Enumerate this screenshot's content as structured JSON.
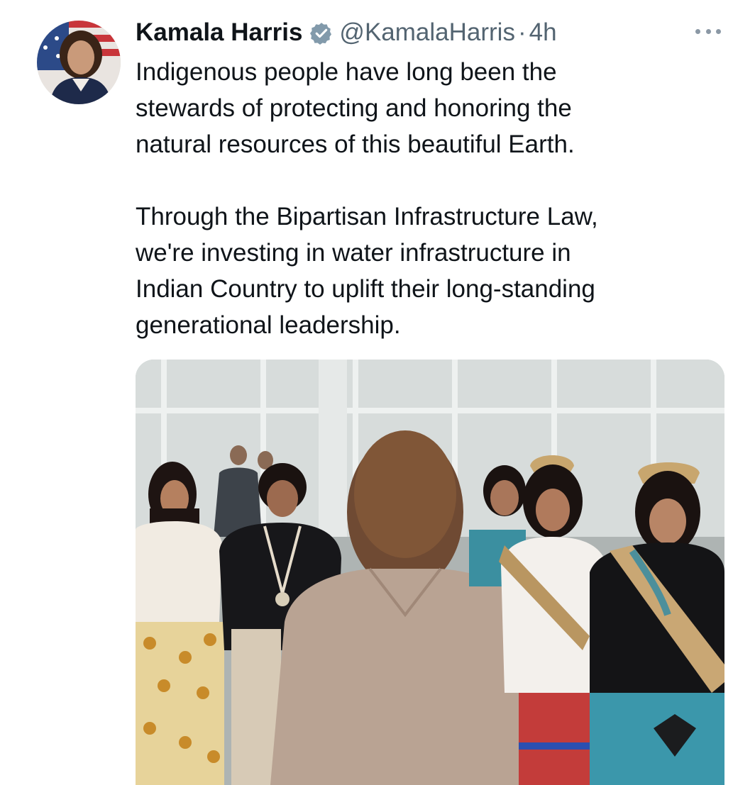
{
  "tweet": {
    "display_name": "Kamala Harris",
    "handle": "@KamalaHarris",
    "separator": "·",
    "time": "4h",
    "verified_icon": "verified-badge-icon",
    "more_icon": "more-options-icon",
    "paragraphs": [
      "Indigenous people have long been the\nstewards of protecting and honoring the\nnatural resources of this beautiful Earth.",
      "Through the Bipartisan Infrastructure Law,\nwe're investing in water infrastructure in\nIndian Country to uplift their long-standing\ngenerational leadership."
    ],
    "avatar_icon": "profile-photo",
    "media_icon": "attached-photo"
  },
  "colors": {
    "text": "#0f1419",
    "secondary": "#536471",
    "verified_badge": "#829aab"
  }
}
